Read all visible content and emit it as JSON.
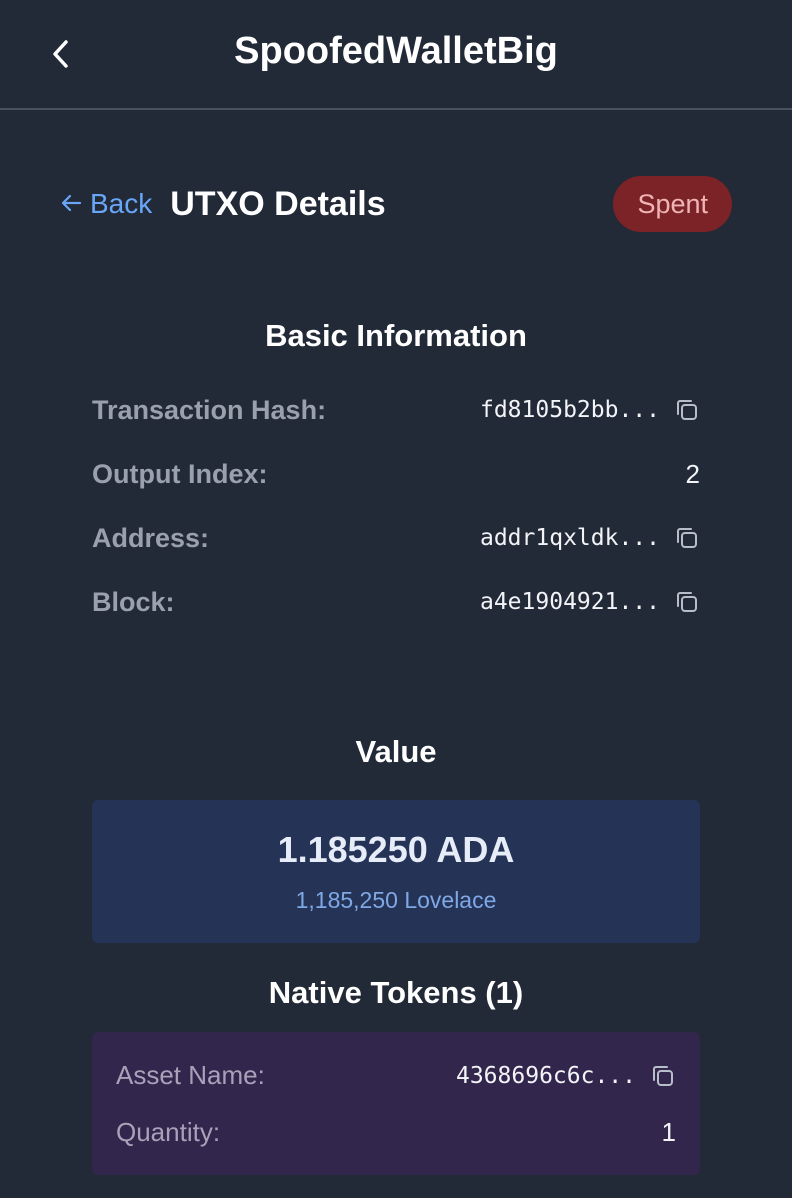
{
  "topbar": {
    "title": "SpoofedWalletBig"
  },
  "header": {
    "back_label": "Back",
    "title": "UTXO Details",
    "status": "Spent"
  },
  "basic": {
    "title": "Basic Information",
    "rows": [
      {
        "label": "Transaction Hash:",
        "value": "fd8105b2bb..."
      },
      {
        "label": "Output Index:",
        "value": "2"
      },
      {
        "label": "Address:",
        "value": "addr1qxldk..."
      },
      {
        "label": "Block:",
        "value": "a4e1904921..."
      }
    ]
  },
  "value": {
    "title": "Value",
    "ada": "1.185250 ADA",
    "lovelace": "1,185,250 Lovelace"
  },
  "tokens": {
    "title": "Native Tokens (1)",
    "items": [
      {
        "asset_label": "Asset Name:",
        "asset_value": "4368696c6c...",
        "qty_label": "Quantity:",
        "qty_value": "1"
      }
    ]
  },
  "colors": {
    "accent": "#6aa6f8",
    "spent_badge": "#7b2326",
    "value_card": "#253356",
    "token_card": "#33264d"
  }
}
